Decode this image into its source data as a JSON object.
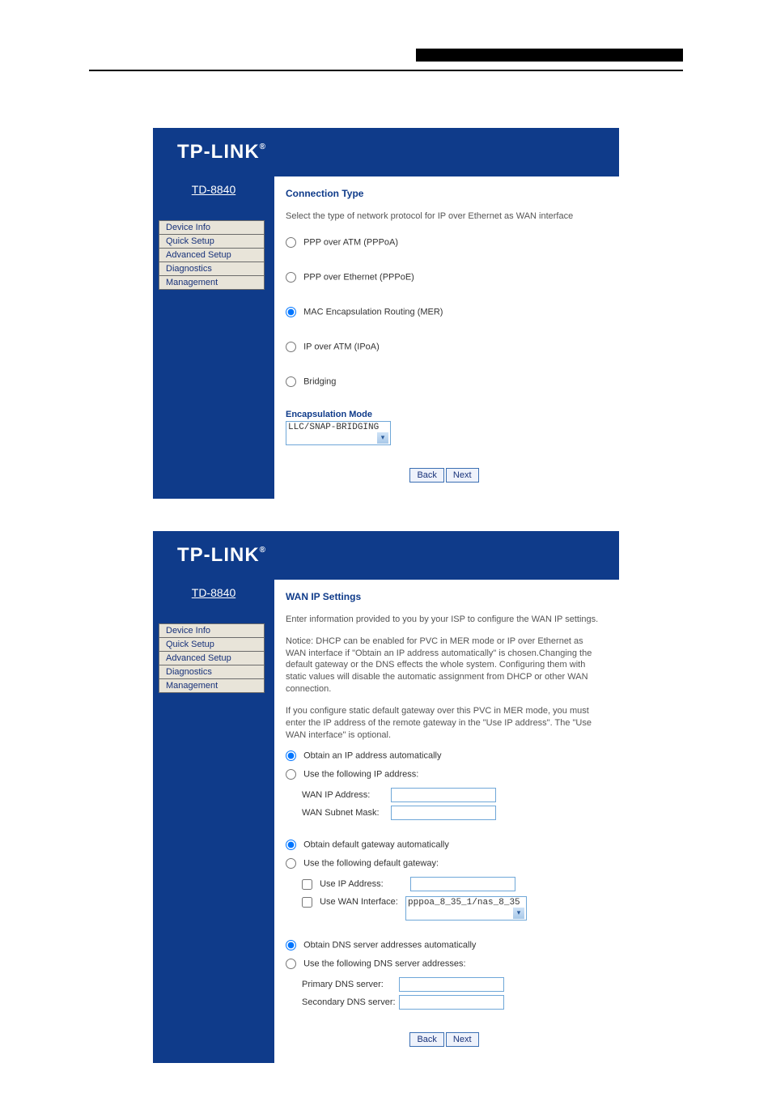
{
  "brand": "TP-LINK",
  "brand_tm": "®",
  "model": "TD-8840",
  "nav": {
    "device_info": "Device Info",
    "quick_setup": "Quick Setup",
    "advanced_setup": "Advanced Setup",
    "diagnostics": "Diagnostics",
    "management": "Management"
  },
  "screen1": {
    "title": "Connection Type",
    "intro": "Select the type of network protocol for IP over Ethernet as WAN interface",
    "opt_pppoa": "PPP over ATM (PPPoA)",
    "opt_pppoe": "PPP over Ethernet (PPPoE)",
    "opt_mer": "MAC Encapsulation Routing (MER)",
    "opt_ipoa": "IP over ATM (IPoA)",
    "opt_bridging": "Bridging",
    "encap_label": "Encapsulation Mode",
    "encap_value": "LLC/SNAP-BRIDGING",
    "back": "Back",
    "next": "Next"
  },
  "screen2": {
    "title": "WAN IP Settings",
    "p1": "Enter information provided to you by your ISP to configure the WAN IP settings.",
    "p2": "Notice: DHCP can be enabled for PVC in MER mode or IP over Ethernet as WAN interface if \"Obtain an IP address automatically\" is chosen.Changing the default gateway or the DNS effects the whole system. Configuring them with static values will disable the automatic assignment from DHCP or other WAN connection.",
    "p3": "If you configure static default gateway over this PVC in MER mode, you must enter the IP address of the remote gateway in the \"Use IP address\". The \"Use WAN interface\" is optional.",
    "ip_auto": "Obtain an IP address automatically",
    "ip_static": "Use the following IP address:",
    "wan_ip_label": "WAN IP Address:",
    "wan_mask_label": "WAN Subnet Mask:",
    "gw_auto": "Obtain default gateway automatically",
    "gw_static": "Use the following default gateway:",
    "use_ip_addr": "Use IP Address:",
    "use_wan_iface": "Use WAN Interface:",
    "wan_iface_value": "pppoa_8_35_1/nas_8_35",
    "dns_auto": "Obtain DNS server addresses automatically",
    "dns_static": "Use the following DNS server addresses:",
    "primary_dns": "Primary DNS server:",
    "secondary_dns": "Secondary DNS server:",
    "back": "Back",
    "next": "Next"
  }
}
